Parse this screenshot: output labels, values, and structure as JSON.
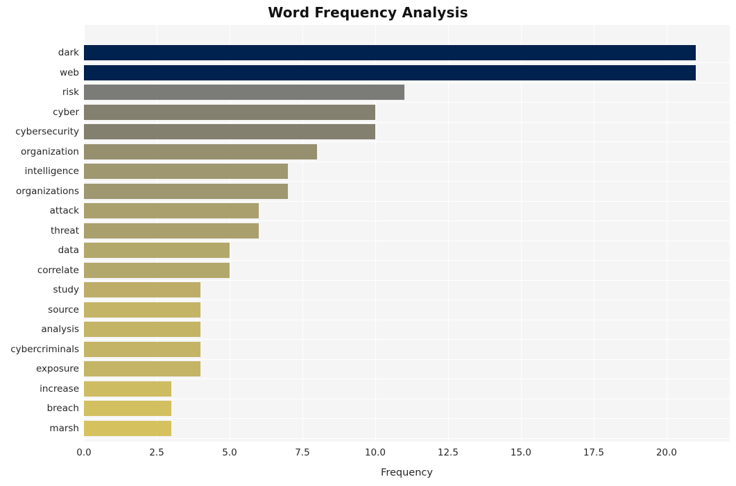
{
  "chart_data": {
    "type": "bar",
    "orientation": "horizontal",
    "title": "Word Frequency Analysis",
    "xlabel": "Frequency",
    "ylabel": "",
    "categories": [
      "dark",
      "web",
      "risk",
      "cyber",
      "cybersecurity",
      "organization",
      "intelligence",
      "organizations",
      "attack",
      "threat",
      "data",
      "correlate",
      "study",
      "source",
      "analysis",
      "cybercriminals",
      "exposure",
      "increase",
      "breach",
      "marsh"
    ],
    "values": [
      21,
      21,
      11,
      10,
      10,
      8,
      7,
      7,
      6,
      6,
      5,
      5,
      4,
      4,
      4,
      4,
      4,
      3,
      3,
      3
    ],
    "bar_colors": [
      "#00224e",
      "#00224e",
      "#7b7b78",
      "#83806f",
      "#83806f",
      "#96906f",
      "#9e9770",
      "#9e9770",
      "#a9a06d",
      "#a9a06d",
      "#b3a86b",
      "#b3a86b",
      "#bdad68",
      "#c4b466",
      "#c4b466",
      "#c4b466",
      "#c4b466",
      "#cebc62",
      "#d2bf60",
      "#d5c25f"
    ],
    "xlim": [
      0,
      22.17
    ],
    "ylim_categories": 20,
    "xticks": [
      0.0,
      2.5,
      5.0,
      7.5,
      10.0,
      12.5,
      15.0,
      17.5,
      20.0
    ],
    "xtick_labels": [
      "0.0",
      "2.5",
      "5.0",
      "7.5",
      "10.0",
      "12.5",
      "15.0",
      "17.5",
      "20.0"
    ],
    "grid": true,
    "grid_color": "#ffffff",
    "plot_background": "#f5f5f6",
    "figure_background": "#ffffff",
    "legend": null,
    "colormap": "cividis_r"
  }
}
